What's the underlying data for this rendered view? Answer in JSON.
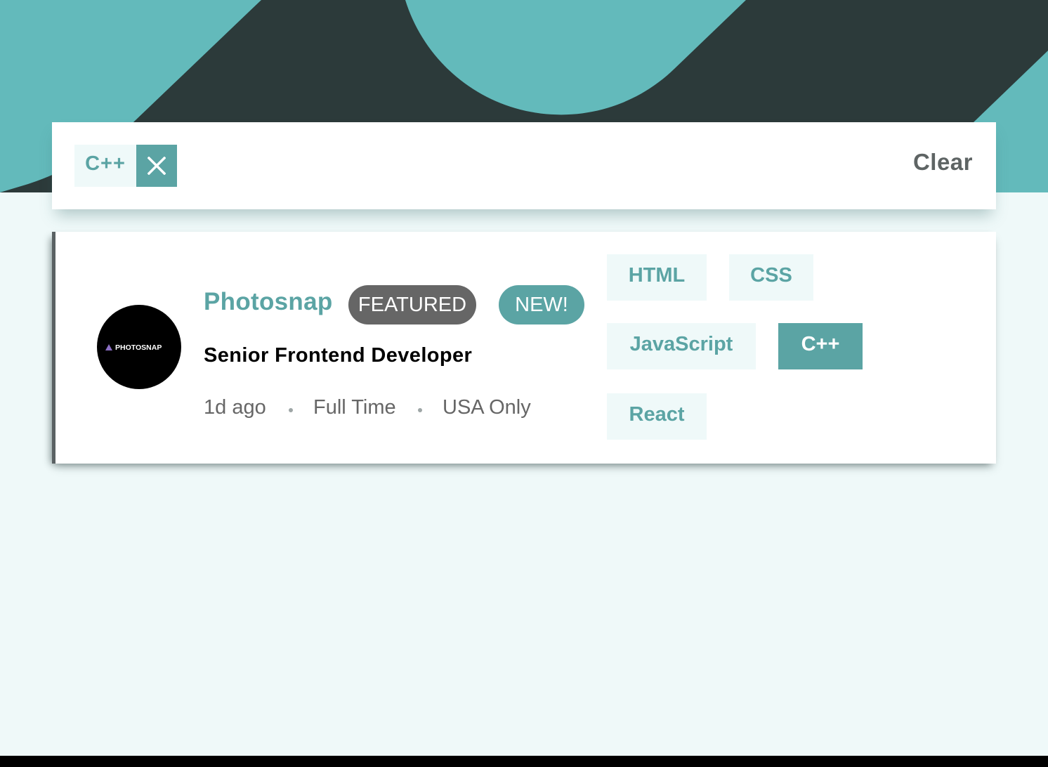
{
  "filter_bar": {
    "active_filters": [
      {
        "label": "C++"
      }
    ],
    "clear_label": "Clear"
  },
  "job": {
    "company": "Photosnap",
    "logo_text": "PHOTOSNAP",
    "featured_label": "FEATURED",
    "new_label": "NEW!",
    "position": "Senior Frontend Developer",
    "posted_at": "1d ago",
    "contract": "Full Time",
    "location": "USA Only",
    "tags": [
      {
        "label": "HTML",
        "active": false
      },
      {
        "label": "CSS",
        "active": false
      },
      {
        "label": "JavaScript",
        "active": false
      },
      {
        "label": "C++",
        "active": true
      },
      {
        "label": "React",
        "active": false
      }
    ]
  },
  "colors": {
    "primary_cyan": "#5ba4a4",
    "light_cyan_bg": "#eff9f9",
    "dark_cyan": "#2c3a3a",
    "featured_gray": "#666666"
  },
  "icons": {
    "remove_filter": "close-icon",
    "logo_mark": "triangle-logo-icon"
  }
}
